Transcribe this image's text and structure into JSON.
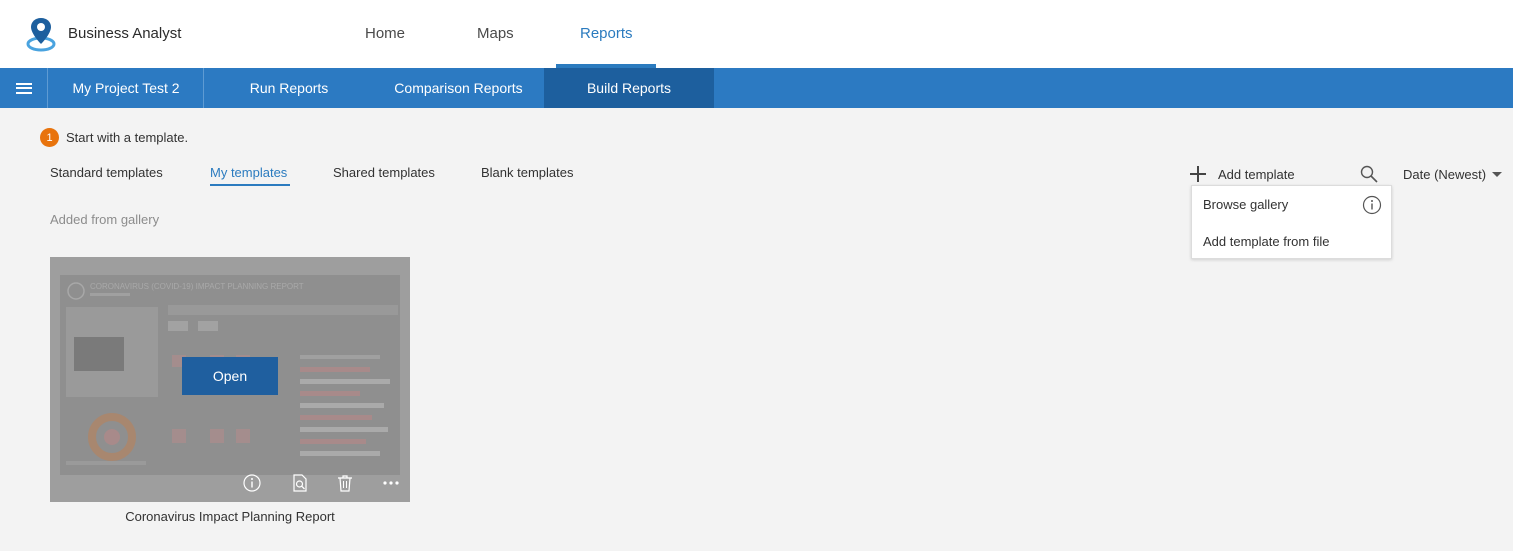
{
  "app": {
    "title": "Business Analyst"
  },
  "top_nav": [
    {
      "label": "Home"
    },
    {
      "label": "Maps"
    },
    {
      "label": "Reports",
      "active": true
    }
  ],
  "project_bar": {
    "project_name": "My Project Test 2",
    "tabs": [
      {
        "label": "Run Reports"
      },
      {
        "label": "Comparison Reports"
      },
      {
        "label": "Build Reports",
        "active": true
      }
    ]
  },
  "step": {
    "number": "1",
    "text": "Start with a template."
  },
  "template_tabs": [
    {
      "label": "Standard templates"
    },
    {
      "label": "My templates",
      "active": true
    },
    {
      "label": "Shared templates"
    },
    {
      "label": "Blank templates"
    }
  ],
  "toolbar": {
    "add_template_label": "Add template",
    "sort_label": "Date (Newest)"
  },
  "add_template_menu": {
    "items": [
      {
        "label": "Browse gallery"
      },
      {
        "label": "Add template from file"
      }
    ]
  },
  "section": {
    "label": "Added from gallery"
  },
  "cards": [
    {
      "title": "Coronavirus Impact Planning Report",
      "open_label": "Open",
      "thumbnail_heading": "CORONAVIRUS (COVID-19) IMPACT PLANNING REPORT"
    }
  ],
  "colors": {
    "accent": "#2b7bbf",
    "nav_bar": "#2c7ac2",
    "nav_active": "#1d5f9e",
    "step_badge": "#e8730c",
    "open_button": "#1f5f9f"
  },
  "icons": {
    "logo": "location-pin-logo-icon",
    "menu": "hamburger-menu-icon",
    "add": "plus-icon",
    "search": "search-icon",
    "sort": "caret-down-icon",
    "info": "info-icon",
    "card_actions": [
      "info-icon",
      "preview-icon",
      "trash-icon",
      "more-icon"
    ]
  }
}
